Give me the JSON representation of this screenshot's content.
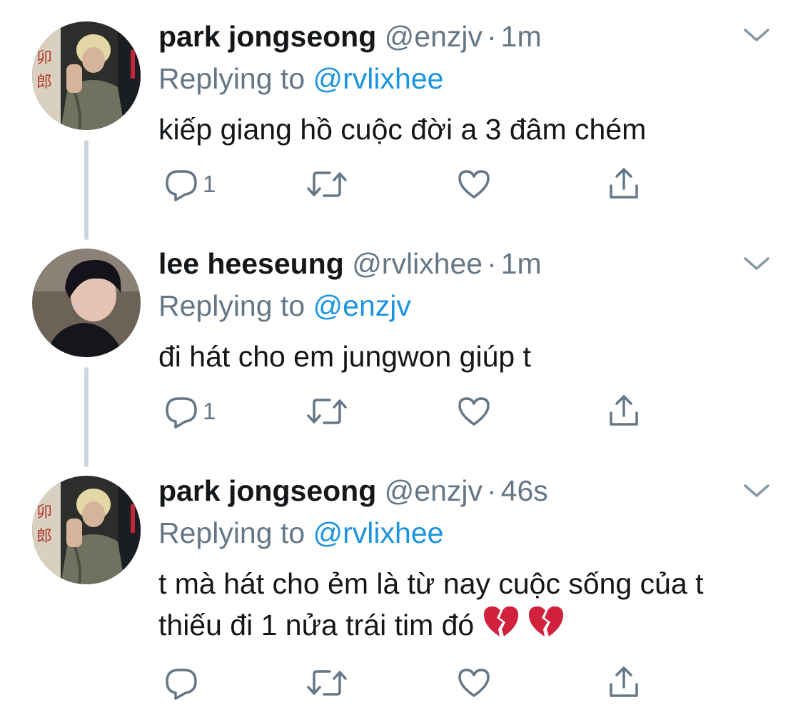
{
  "tweets": [
    {
      "name": "park jongseong",
      "handle": "@enzjv",
      "dot": "·",
      "time": "1m",
      "reply_prefix": "Replying to",
      "reply_to": "@rvlixhee",
      "text_lines": [
        "kiếp giang hồ cuộc đời a 3 đâm chém"
      ],
      "reply_count": "1",
      "avatar": "photo-person-blond-hair"
    },
    {
      "name": "lee heeseung",
      "handle": "@rvlixhee",
      "dot": "·",
      "time": "1m",
      "reply_prefix": "Replying to",
      "reply_to": "@enzjv",
      "text_lines": [
        "đi hát cho em jungwon giúp t"
      ],
      "reply_count": "1",
      "avatar": "photo-person-dark-hair"
    },
    {
      "name": "park jongseong",
      "handle": "@enzjv",
      "dot": "·",
      "time": "46s",
      "reply_prefix": "Replying to",
      "reply_to": "@rvlixhee",
      "text_lines": [
        "t mà hát cho ẻm là từ nay cuộc sống của t",
        "thiếu đi 1 nửa trái tim đó"
      ],
      "emojis": [
        "broken-heart",
        "broken-heart"
      ],
      "reply_count": "",
      "avatar": "photo-person-blond-hair"
    }
  ],
  "icons": {
    "reply": "reply-icon",
    "retweet": "retweet-icon",
    "like": "heart-icon",
    "share": "share-icon",
    "menu": "chevron-down-icon"
  },
  "colors": {
    "text": "#14171a",
    "muted": "#657786",
    "link": "#1b95e0",
    "thread_line": "#ccd6dd",
    "broken_heart": "#d1213d"
  }
}
